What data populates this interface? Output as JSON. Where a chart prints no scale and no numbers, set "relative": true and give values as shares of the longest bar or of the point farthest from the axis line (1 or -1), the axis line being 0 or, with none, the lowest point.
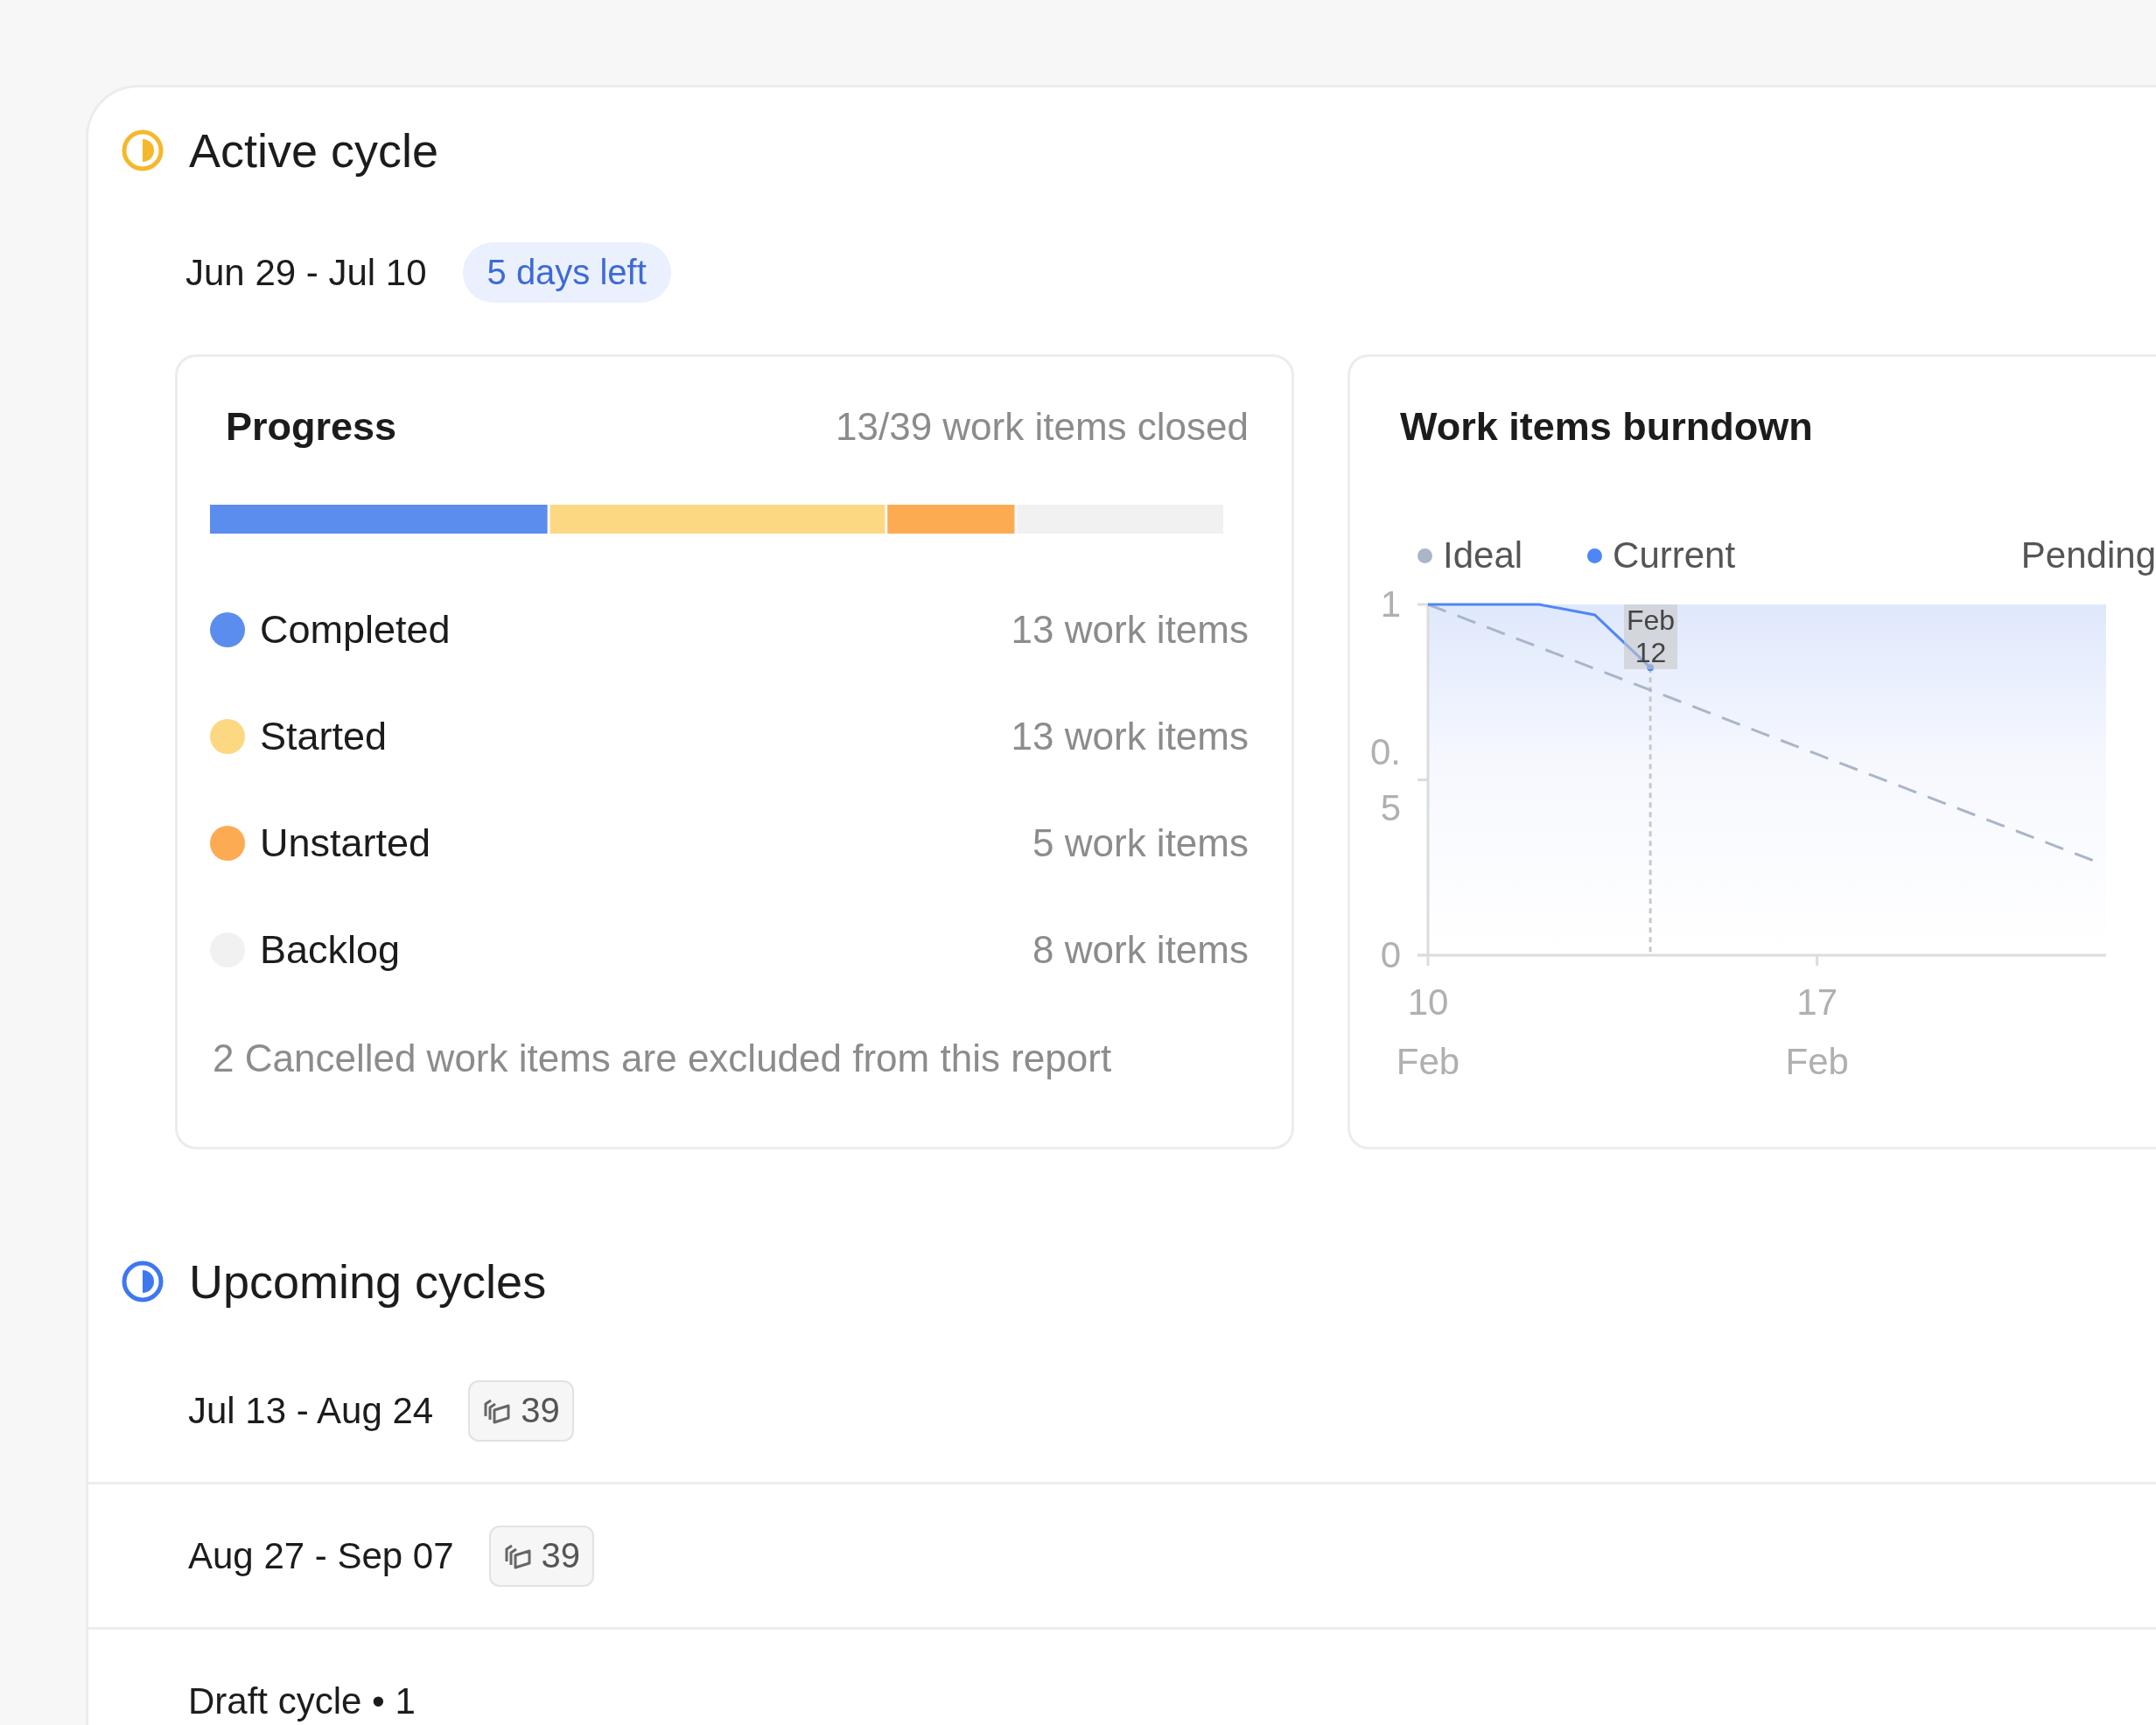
{
  "active_cycle": {
    "title": "Active cycle",
    "date_range": "Jun 29 - Jul 10",
    "days_left": "5 days left"
  },
  "progress": {
    "title": "Progress",
    "summary": "13/39 work items closed",
    "chart_data": {
      "type": "bar",
      "orientation": "horizontal",
      "stacked": true,
      "relative": true,
      "series": [
        {
          "name": "Completed",
          "color": "#5b8def",
          "values": [
            0.333
          ]
        },
        {
          "name": "Started",
          "color": "#fcd883",
          "values": [
            0.333
          ]
        },
        {
          "name": "Unstarted",
          "color": "#fdab52",
          "values": [
            0.128
          ]
        },
        {
          "name": "Backlog",
          "color": "#f1f1f1",
          "values": [
            0.206
          ]
        }
      ]
    },
    "counts": [
      "13 work items",
      "13 work items",
      "5 work items",
      "8 work items"
    ],
    "note": "2 Cancelled work items are excluded from this report"
  },
  "burndown": {
    "title": "Work items burndown",
    "pending_label": "Pending",
    "x_month_labels": [
      "Feb",
      "Feb"
    ],
    "chart_data": {
      "type": "line",
      "annotations": [
        {
          "x": 14,
          "text": "Feb 12"
        }
      ],
      "x": [
        10,
        11,
        12,
        13,
        14,
        15,
        16,
        17,
        18,
        19,
        20,
        21,
        22
      ],
      "xlim": [
        10,
        22.2
      ],
      "ylim": [
        0,
        1
      ],
      "xticks": [
        10,
        17
      ],
      "yticks": [
        0,
        0.5,
        1
      ],
      "series": [
        {
          "name": "Ideal",
          "color": "#a9b6c8",
          "line_style": "dashed",
          "values": [
            1,
            0.939,
            0.878,
            0.817,
            0.756,
            0.695,
            0.634,
            0.573,
            0.512,
            0.451,
            0.39,
            0.329,
            0.268
          ]
        },
        {
          "name": "Current",
          "color": "#4f86f7",
          "line_style": "solid",
          "values": [
            1,
            1,
            1,
            0.97,
            0.82,
            null,
            null,
            null,
            null,
            null,
            null,
            null,
            null
          ]
        }
      ]
    }
  },
  "upcoming": {
    "title": "Upcoming cycles",
    "cycles": [
      {
        "kind": "scheduled",
        "date_range": "Jul 13 - Aug 24",
        "count": "39"
      },
      {
        "kind": "scheduled",
        "date_range": "Aug 27 - Sep 07",
        "count": "39"
      },
      {
        "kind": "draft",
        "label": "Draft cycle • 1"
      }
    ]
  }
}
